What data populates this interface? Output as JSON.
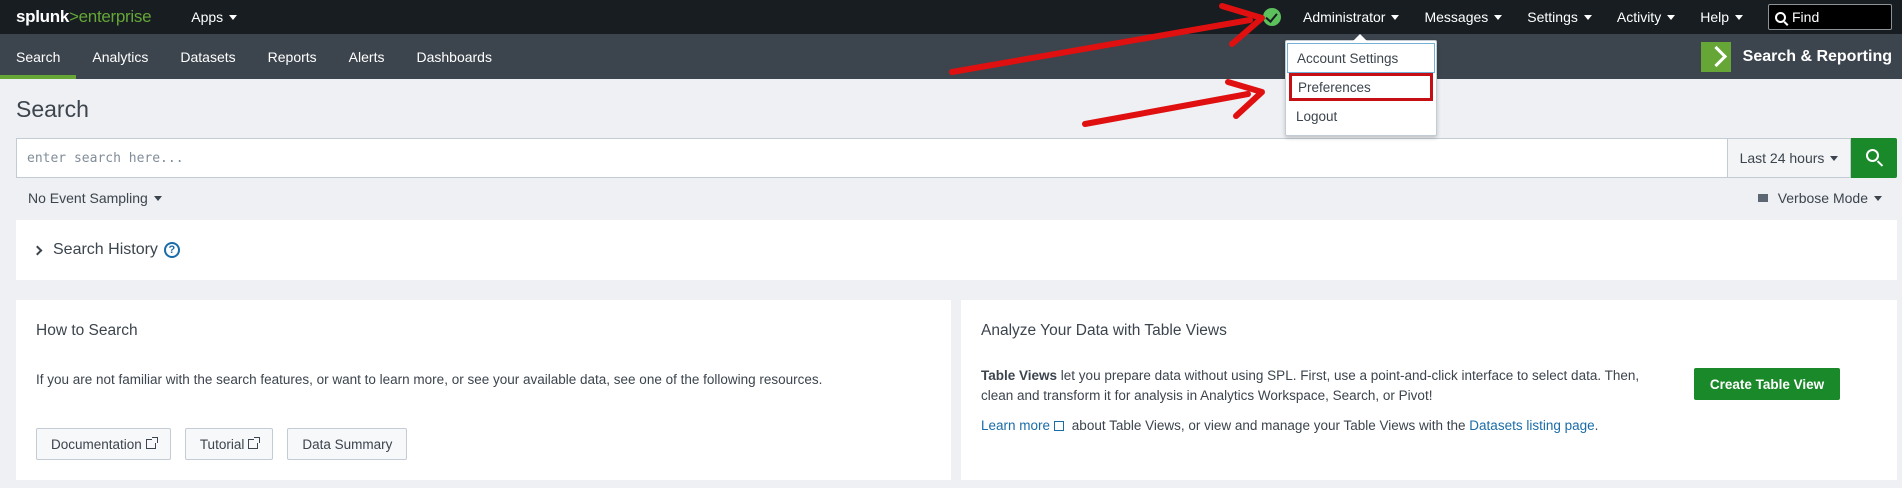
{
  "topbar": {
    "logo_main": "splunk",
    "logo_sep": ">",
    "logo_sub": "enterprise",
    "apps_label": "Apps",
    "menus": [
      "Administrator",
      "Messages",
      "Settings",
      "Activity",
      "Help"
    ],
    "find_label": "Find"
  },
  "appbar": {
    "tabs": [
      "Search",
      "Analytics",
      "Datasets",
      "Reports",
      "Alerts",
      "Dashboards"
    ],
    "active_tab": "Search",
    "app_title": "Search & Reporting"
  },
  "user_dropdown": {
    "items": [
      "Account Settings",
      "Preferences",
      "Logout"
    ]
  },
  "page": {
    "title": "Search"
  },
  "search": {
    "placeholder": "enter search here...",
    "time_range": "Last 24 hours",
    "sampling": "No Event Sampling",
    "mode": "Verbose Mode"
  },
  "history": {
    "label": "Search History",
    "help_glyph": "?"
  },
  "how_to_search": {
    "title": "How to Search",
    "description": "If you are not familiar with the search features, or want to learn more, or see your available data, see one of the following resources.",
    "buttons": [
      "Documentation",
      "Tutorial",
      "Data Summary"
    ]
  },
  "table_views": {
    "title": "Analyze Your Data with Table Views",
    "bold_lead": "Table Views",
    "description": " let you prepare data without using SPL. First, use a point-and-click interface to select data. Then, clean and transform it for analysis in Analytics Workspace, Search, or Pivot!",
    "learn_more": "Learn more",
    "middle_text": " about Table Views, or view and manage your Table Views with the ",
    "datasets_link": "Datasets listing page",
    "end_text": ".",
    "create_button": "Create Table View"
  },
  "colors": {
    "accent_green": "#65a637",
    "button_green": "#1a8929",
    "annotation_red": "#e01010",
    "link_blue": "#1a6ca8"
  }
}
